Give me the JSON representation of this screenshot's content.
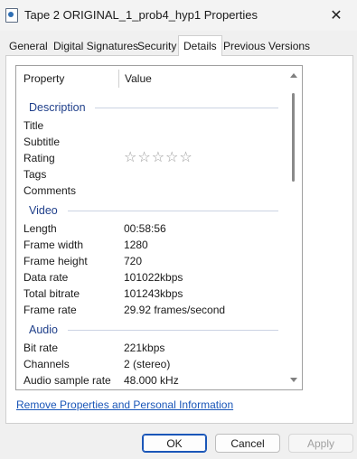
{
  "window": {
    "title": "Tape 2 ORIGINAL_1_prob4_hyp1 Properties",
    "close_glyph": "✕"
  },
  "tabs": [
    {
      "label": "General"
    },
    {
      "label": "Digital Signatures"
    },
    {
      "label": "Security"
    },
    {
      "label": "Details"
    },
    {
      "label": "Previous Versions"
    }
  ],
  "details": {
    "col_property": "Property",
    "col_value": "Value",
    "description": {
      "heading": "Description",
      "title": "Title",
      "subtitle": "Subtitle",
      "rating": "Rating",
      "rating_value": 0,
      "rating_max": 5,
      "rating_stars": "☆☆☆☆☆",
      "tags": "Tags",
      "comments": "Comments"
    },
    "video": {
      "heading": "Video",
      "rows": [
        {
          "k": "Length",
          "v": "00:58:56"
        },
        {
          "k": "Frame width",
          "v": "1280"
        },
        {
          "k": "Frame height",
          "v": "720"
        },
        {
          "k": "Data rate",
          "v": "101022kbps"
        },
        {
          "k": "Total bitrate",
          "v": "101243kbps"
        },
        {
          "k": "Frame rate",
          "v": "29.92 frames/second"
        }
      ]
    },
    "audio": {
      "heading": "Audio",
      "rows": [
        {
          "k": "Bit rate",
          "v": "221kbps"
        },
        {
          "k": "Channels",
          "v": "2 (stereo)"
        },
        {
          "k": "Audio sample rate",
          "v": "48.000 kHz"
        }
      ]
    }
  },
  "remove_link": "Remove Properties and Personal Information",
  "buttons": {
    "ok": "OK",
    "cancel": "Cancel",
    "apply": "Apply"
  }
}
